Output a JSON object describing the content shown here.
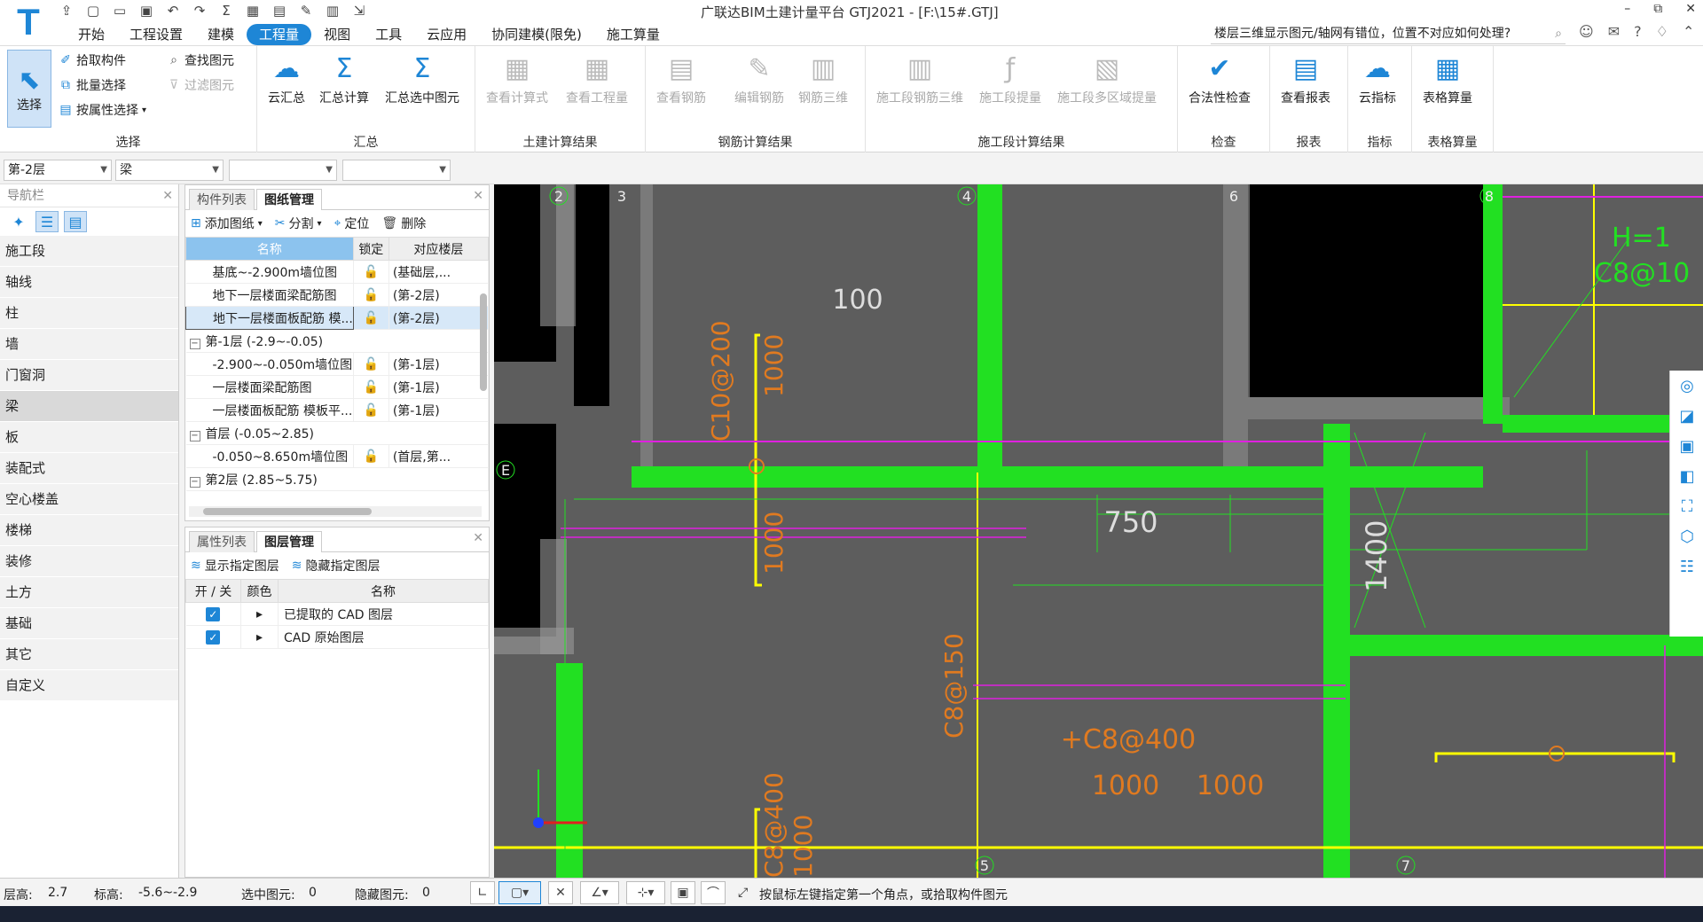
{
  "app": {
    "title": "广联达BIM土建计量平台 GTJ2021 - [F:\\15#.GTJ]",
    "logo_letter": "T"
  },
  "window_controls": [
    "–",
    "⧉",
    "✕"
  ],
  "menu": [
    {
      "label": "开始"
    },
    {
      "label": "工程设置"
    },
    {
      "label": "建模"
    },
    {
      "label": "工程量",
      "active": true
    },
    {
      "label": "视图"
    },
    {
      "label": "工具"
    },
    {
      "label": "云应用"
    },
    {
      "label": "协同建模(限免)"
    },
    {
      "label": "施工算量"
    }
  ],
  "help_search": {
    "text": "楼层三维显示图元/轴网有错位，位置不对应如何处理?"
  },
  "ribbon": {
    "select": {
      "label": "选择",
      "group": "选择",
      "pick": "拾取构件",
      "batch": "批量选择",
      "by_attr": "按属性选择",
      "find": "查找图元",
      "filter": "过滤图元"
    },
    "summary": {
      "group": "汇总",
      "cloud": "云汇总",
      "calc": "汇总计算",
      "selected": "汇总选中图元"
    },
    "civil": {
      "group": "土建计算结果",
      "formula": "查看计算式",
      "qty": "查看工程量"
    },
    "rebar": {
      "group": "钢筋计算结果",
      "view": "查看钢筋",
      "edit": "编辑钢筋",
      "r3d": "钢筋三维"
    },
    "phase": {
      "group": "施工段计算结果",
      "r3d": "施工段钢筋三维",
      "extract": "施工段提量",
      "multi": "施工段多区域提量"
    },
    "check": {
      "group": "检查",
      "legal": "合法性检查"
    },
    "report": {
      "group": "报表",
      "view": "查看报表"
    },
    "index": {
      "group": "指标",
      "cloud": "云指标"
    },
    "table": {
      "group": "表格算量",
      "calc": "表格算量"
    }
  },
  "dropdowns": [
    "第-2层",
    "梁",
    "",
    ""
  ],
  "nav": {
    "title": "导航栏",
    "items": [
      "施工段",
      "轴线",
      "柱",
      "墙",
      "门窗洞",
      "梁",
      "板",
      "装配式",
      "空心楼盖",
      "楼梯",
      "装修",
      "土方",
      "基础",
      "其它",
      "自定义"
    ],
    "active": "梁"
  },
  "drawing_panel": {
    "tabs": [
      "构件列表",
      "图纸管理"
    ],
    "toolbar": [
      "添加图纸",
      "分割",
      "定位",
      "删除"
    ],
    "columns": [
      "名称",
      "锁定",
      "对应楼层"
    ],
    "rows": [
      {
        "type": "item",
        "name": "基底~-2.900m墙位图",
        "floor": "(基础层,..."
      },
      {
        "type": "item",
        "name": "地下一层楼面梁配筋图",
        "floor": "(第-2层)"
      },
      {
        "type": "item",
        "name": "地下一层楼面板配筋 模...",
        "floor": "(第-2层)",
        "selected": true
      },
      {
        "type": "group",
        "name": "第-1层 (-2.9~-0.05)"
      },
      {
        "type": "item",
        "name": "-2.900~-0.050m墙位图",
        "floor": "(第-1层)"
      },
      {
        "type": "item",
        "name": "一层楼面梁配筋图",
        "floor": "(第-1层)"
      },
      {
        "type": "item",
        "name": "一层楼面板配筋 模板平...",
        "floor": "(第-1层)"
      },
      {
        "type": "group",
        "name": "首层 (-0.05~2.85)"
      },
      {
        "type": "item",
        "name": "-0.050~8.650m墙位图",
        "floor": "(首层,第..."
      },
      {
        "type": "group",
        "name": "第2层 (2.85~5.75)"
      }
    ]
  },
  "layer_panel": {
    "tabs": [
      "属性列表",
      "图层管理"
    ],
    "toolbar": [
      "显示指定图层",
      "隐藏指定图层"
    ],
    "columns": [
      "开 / 关",
      "颜色",
      "名称"
    ],
    "rows": [
      {
        "name": "已提取的 CAD 图层",
        "on": true
      },
      {
        "name": "CAD 原始图层",
        "on": true
      }
    ]
  },
  "canvas": {
    "axis_labels": [
      "2",
      "3",
      "4",
      "6",
      "8",
      "5",
      "7",
      "E",
      "E"
    ],
    "annotations": [
      "100",
      "C10@200",
      "1000",
      "1000",
      "C8@150",
      "750",
      "1400",
      "+C8@400",
      "1000",
      "1000",
      "C8@400",
      "1000",
      "H=1",
      "C8@10"
    ]
  },
  "status": {
    "floor_height_label": "层高:",
    "floor_height": "2.7",
    "elev_label": "标高:",
    "elev": "-5.6~-2.9",
    "selected_label": "选中图元:",
    "selected": "0",
    "hidden_label": "隐藏图元:",
    "hidden": "0",
    "hint": "按鼠标左键指定第一个角点，或拾取构件图元"
  },
  "colors": {
    "accent": "#1e86d6",
    "canvas": "#5d5d5d",
    "wall_green": "#22e022",
    "beam_yellow": "#ffff00",
    "magenta": "#e020e0",
    "annot_orange": "#e07a20"
  }
}
